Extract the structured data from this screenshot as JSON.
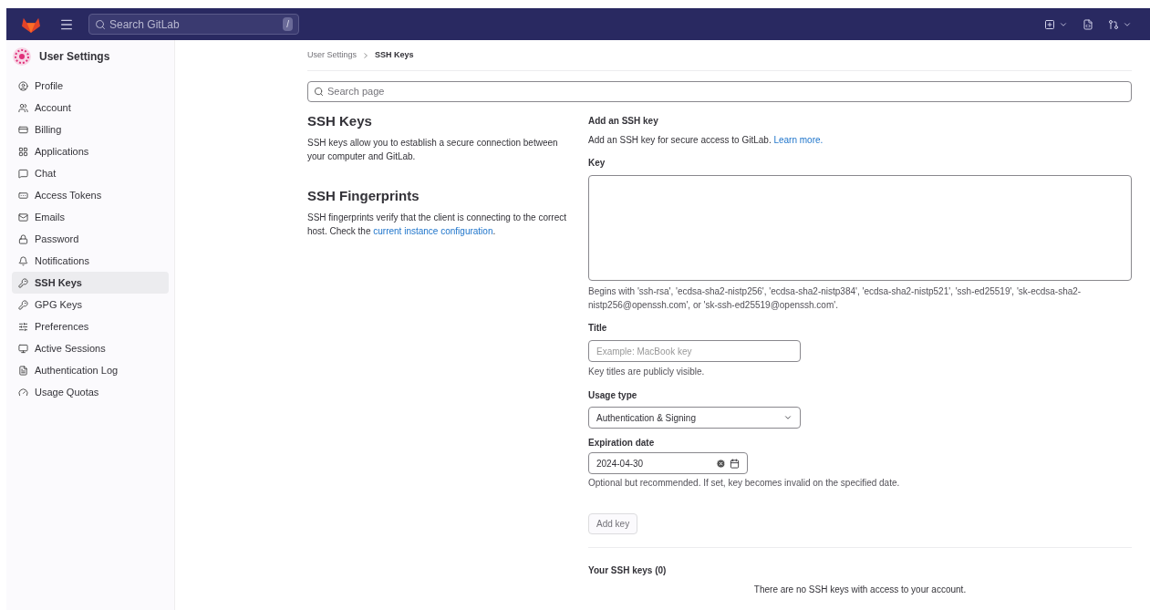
{
  "topbar": {
    "search_placeholder": "Search GitLab",
    "search_shortcut": "/"
  },
  "sidebar": {
    "title": "User Settings",
    "items": [
      {
        "label": "Profile",
        "selected": false
      },
      {
        "label": "Account",
        "selected": false
      },
      {
        "label": "Billing",
        "selected": false
      },
      {
        "label": "Applications",
        "selected": false
      },
      {
        "label": "Chat",
        "selected": false
      },
      {
        "label": "Access Tokens",
        "selected": false
      },
      {
        "label": "Emails",
        "selected": false
      },
      {
        "label": "Password",
        "selected": false
      },
      {
        "label": "Notifications",
        "selected": false
      },
      {
        "label": "SSH Keys",
        "selected": true
      },
      {
        "label": "GPG Keys",
        "selected": false
      },
      {
        "label": "Preferences",
        "selected": false
      },
      {
        "label": "Active Sessions",
        "selected": false
      },
      {
        "label": "Authentication Log",
        "selected": false
      },
      {
        "label": "Usage Quotas",
        "selected": false
      }
    ]
  },
  "breadcrumb": [
    "User Settings",
    "SSH Keys"
  ],
  "search_page": {
    "placeholder": "Search page"
  },
  "intro": [
    {
      "heading": "SSH Keys",
      "text": "SSH keys allow you to establish a secure connection between your computer and GitLab."
    },
    {
      "heading": "SSH Fingerprints",
      "text": "SSH fingerprints verify that the client is connecting to the correct host. Check the ",
      "link": "current instance configuration",
      "after": "."
    }
  ],
  "form": {
    "heading": "Add an SSH key",
    "description": "Add an SSH key for secure access to GitLab. ",
    "description_link": "Learn more.",
    "key_label": "Key",
    "key_help": "Begins with 'ssh-rsa', 'ecdsa-sha2-nistp256', 'ecdsa-sha2-nistp384', 'ecdsa-sha2-nistp521', 'ssh-ed25519', 'sk-ecdsa-sha2-nistp256@openssh.com', or 'sk-ssh-ed25519@openssh.com'.",
    "title_label": "Title",
    "title_placeholder": "Example: MacBook key",
    "title_help": "Key titles are publicly visible.",
    "usage_label": "Usage type",
    "usage_value": "Authentication & Signing",
    "expiration_label": "Expiration date",
    "expiration_value": "2024-04-30",
    "expiration_help": "Optional but recommended. If set, key becomes invalid on the specified date.",
    "submit": {
      "label": "Add key",
      "disabled": true
    }
  },
  "keys": {
    "heading": "Your SSH keys (0)",
    "empty": "There are no SSH keys with access to your account."
  }
}
